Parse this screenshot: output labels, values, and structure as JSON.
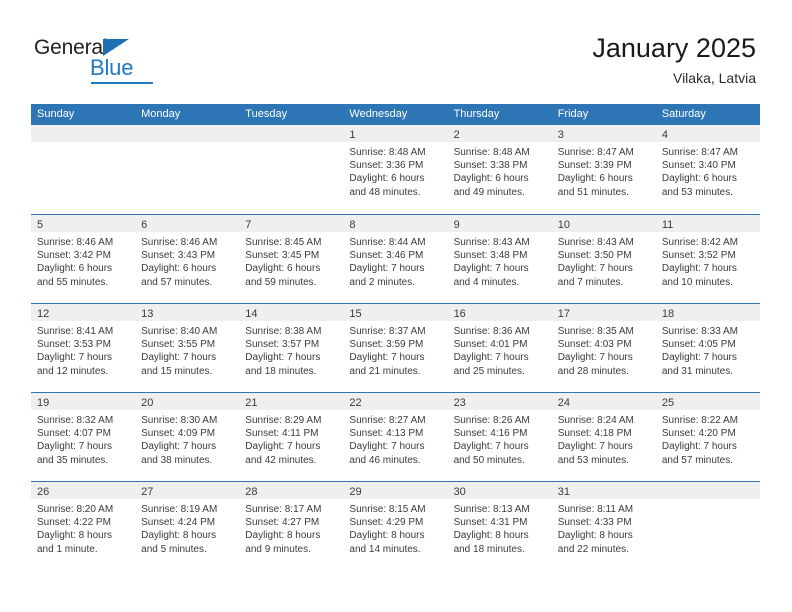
{
  "brand": {
    "name_part1": "General",
    "name_part2": "Blue",
    "triangle_icon": "triangle-icon",
    "accent_color": "#1f7ac0"
  },
  "header": {
    "title": "January 2025",
    "subtitle": "Vilaka, Latvia"
  },
  "theme": {
    "header_bg": "#2e75b6",
    "header_text": "#ffffff",
    "daynum_strip_bg": "#efefef",
    "cell_bg": "#ffffff",
    "text": "#3b3b3b"
  },
  "weekday_headers": [
    "Sunday",
    "Monday",
    "Tuesday",
    "Wednesday",
    "Thursday",
    "Friday",
    "Saturday"
  ],
  "weeks": [
    [
      {
        "day": "",
        "lines": []
      },
      {
        "day": "",
        "lines": []
      },
      {
        "day": "",
        "lines": []
      },
      {
        "day": "1",
        "lines": [
          "Sunrise: 8:48 AM",
          "Sunset: 3:36 PM",
          "Daylight: 6 hours",
          "and 48 minutes."
        ]
      },
      {
        "day": "2",
        "lines": [
          "Sunrise: 8:48 AM",
          "Sunset: 3:38 PM",
          "Daylight: 6 hours",
          "and 49 minutes."
        ]
      },
      {
        "day": "3",
        "lines": [
          "Sunrise: 8:47 AM",
          "Sunset: 3:39 PM",
          "Daylight: 6 hours",
          "and 51 minutes."
        ]
      },
      {
        "day": "4",
        "lines": [
          "Sunrise: 8:47 AM",
          "Sunset: 3:40 PM",
          "Daylight: 6 hours",
          "and 53 minutes."
        ]
      }
    ],
    [
      {
        "day": "5",
        "lines": [
          "Sunrise: 8:46 AM",
          "Sunset: 3:42 PM",
          "Daylight: 6 hours",
          "and 55 minutes."
        ]
      },
      {
        "day": "6",
        "lines": [
          "Sunrise: 8:46 AM",
          "Sunset: 3:43 PM",
          "Daylight: 6 hours",
          "and 57 minutes."
        ]
      },
      {
        "day": "7",
        "lines": [
          "Sunrise: 8:45 AM",
          "Sunset: 3:45 PM",
          "Daylight: 6 hours",
          "and 59 minutes."
        ]
      },
      {
        "day": "8",
        "lines": [
          "Sunrise: 8:44 AM",
          "Sunset: 3:46 PM",
          "Daylight: 7 hours",
          "and 2 minutes."
        ]
      },
      {
        "day": "9",
        "lines": [
          "Sunrise: 8:43 AM",
          "Sunset: 3:48 PM",
          "Daylight: 7 hours",
          "and 4 minutes."
        ]
      },
      {
        "day": "10",
        "lines": [
          "Sunrise: 8:43 AM",
          "Sunset: 3:50 PM",
          "Daylight: 7 hours",
          "and 7 minutes."
        ]
      },
      {
        "day": "11",
        "lines": [
          "Sunrise: 8:42 AM",
          "Sunset: 3:52 PM",
          "Daylight: 7 hours",
          "and 10 minutes."
        ]
      }
    ],
    [
      {
        "day": "12",
        "lines": [
          "Sunrise: 8:41 AM",
          "Sunset: 3:53 PM",
          "Daylight: 7 hours",
          "and 12 minutes."
        ]
      },
      {
        "day": "13",
        "lines": [
          "Sunrise: 8:40 AM",
          "Sunset: 3:55 PM",
          "Daylight: 7 hours",
          "and 15 minutes."
        ]
      },
      {
        "day": "14",
        "lines": [
          "Sunrise: 8:38 AM",
          "Sunset: 3:57 PM",
          "Daylight: 7 hours",
          "and 18 minutes."
        ]
      },
      {
        "day": "15",
        "lines": [
          "Sunrise: 8:37 AM",
          "Sunset: 3:59 PM",
          "Daylight: 7 hours",
          "and 21 minutes."
        ]
      },
      {
        "day": "16",
        "lines": [
          "Sunrise: 8:36 AM",
          "Sunset: 4:01 PM",
          "Daylight: 7 hours",
          "and 25 minutes."
        ]
      },
      {
        "day": "17",
        "lines": [
          "Sunrise: 8:35 AM",
          "Sunset: 4:03 PM",
          "Daylight: 7 hours",
          "and 28 minutes."
        ]
      },
      {
        "day": "18",
        "lines": [
          "Sunrise: 8:33 AM",
          "Sunset: 4:05 PM",
          "Daylight: 7 hours",
          "and 31 minutes."
        ]
      }
    ],
    [
      {
        "day": "19",
        "lines": [
          "Sunrise: 8:32 AM",
          "Sunset: 4:07 PM",
          "Daylight: 7 hours",
          "and 35 minutes."
        ]
      },
      {
        "day": "20",
        "lines": [
          "Sunrise: 8:30 AM",
          "Sunset: 4:09 PM",
          "Daylight: 7 hours",
          "and 38 minutes."
        ]
      },
      {
        "day": "21",
        "lines": [
          "Sunrise: 8:29 AM",
          "Sunset: 4:11 PM",
          "Daylight: 7 hours",
          "and 42 minutes."
        ]
      },
      {
        "day": "22",
        "lines": [
          "Sunrise: 8:27 AM",
          "Sunset: 4:13 PM",
          "Daylight: 7 hours",
          "and 46 minutes."
        ]
      },
      {
        "day": "23",
        "lines": [
          "Sunrise: 8:26 AM",
          "Sunset: 4:16 PM",
          "Daylight: 7 hours",
          "and 50 minutes."
        ]
      },
      {
        "day": "24",
        "lines": [
          "Sunrise: 8:24 AM",
          "Sunset: 4:18 PM",
          "Daylight: 7 hours",
          "and 53 minutes."
        ]
      },
      {
        "day": "25",
        "lines": [
          "Sunrise: 8:22 AM",
          "Sunset: 4:20 PM",
          "Daylight: 7 hours",
          "and 57 minutes."
        ]
      }
    ],
    [
      {
        "day": "26",
        "lines": [
          "Sunrise: 8:20 AM",
          "Sunset: 4:22 PM",
          "Daylight: 8 hours",
          "and 1 minute."
        ]
      },
      {
        "day": "27",
        "lines": [
          "Sunrise: 8:19 AM",
          "Sunset: 4:24 PM",
          "Daylight: 8 hours",
          "and 5 minutes."
        ]
      },
      {
        "day": "28",
        "lines": [
          "Sunrise: 8:17 AM",
          "Sunset: 4:27 PM",
          "Daylight: 8 hours",
          "and 9 minutes."
        ]
      },
      {
        "day": "29",
        "lines": [
          "Sunrise: 8:15 AM",
          "Sunset: 4:29 PM",
          "Daylight: 8 hours",
          "and 14 minutes."
        ]
      },
      {
        "day": "30",
        "lines": [
          "Sunrise: 8:13 AM",
          "Sunset: 4:31 PM",
          "Daylight: 8 hours",
          "and 18 minutes."
        ]
      },
      {
        "day": "31",
        "lines": [
          "Sunrise: 8:11 AM",
          "Sunset: 4:33 PM",
          "Daylight: 8 hours",
          "and 22 minutes."
        ]
      },
      {
        "day": "",
        "lines": []
      }
    ]
  ]
}
